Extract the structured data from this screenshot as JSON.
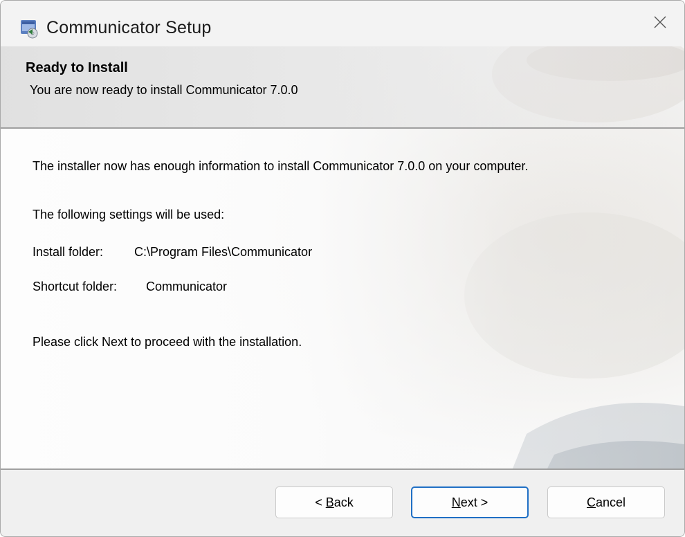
{
  "window": {
    "title": "Communicator Setup",
    "close_glyph": "✕",
    "icon": "installer-app-icon"
  },
  "header": {
    "title": "Ready to Install",
    "subtitle": "You are now ready to install Communicator 7.0.0"
  },
  "body": {
    "intro": "The installer now has enough information to install Communicator 7.0.0 on your computer.",
    "settings_heading": "The following settings will be used:",
    "install_folder_label": "Install folder:",
    "install_folder_value": "C:\\Program Files\\Communicator",
    "shortcut_folder_label": "Shortcut folder:",
    "shortcut_folder_value": "Communicator",
    "instruction": "Please click Next to proceed with the installation."
  },
  "buttons": {
    "back": {
      "prefix": "< ",
      "mnemonic": "B",
      "rest": "ack"
    },
    "next": {
      "prefix": "",
      "mnemonic": "N",
      "rest": "ext >"
    },
    "cancel": {
      "prefix": "",
      "mnemonic": "C",
      "rest": "ancel"
    }
  },
  "colors": {
    "accent": "#1f6fc5",
    "window_bg": "#f3f3f3"
  }
}
